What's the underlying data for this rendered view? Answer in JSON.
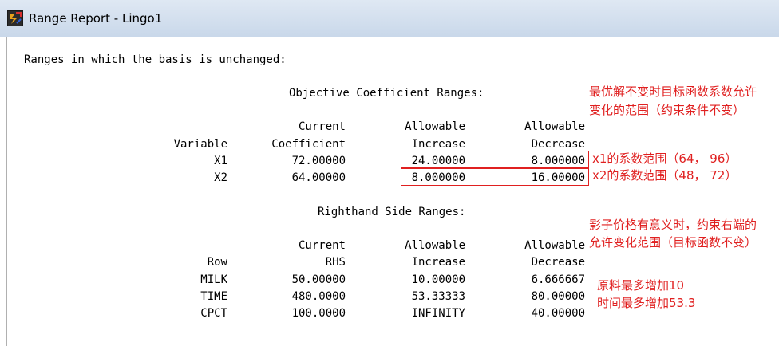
{
  "window": {
    "title": "Range Report - Lingo1",
    "icon": "lingo-app-icon"
  },
  "report": {
    "intro": "Ranges in which the basis is unchanged:",
    "objective": {
      "heading": "Objective Coefficient Ranges:",
      "header1": [
        "Current",
        "Allowable",
        "Allowable"
      ],
      "header2": [
        "Variable",
        "Coefficient",
        "Increase",
        "Decrease"
      ],
      "rows": [
        [
          "X1",
          "72.00000",
          "24.00000",
          "8.000000"
        ],
        [
          "X2",
          "64.00000",
          "8.000000",
          "16.00000"
        ]
      ]
    },
    "rhs": {
      "heading": "Righthand Side Ranges:",
      "header1": [
        "Current",
        "Allowable",
        "Allowable"
      ],
      "header2": [
        "Row",
        "RHS",
        "Increase",
        "Decrease"
      ],
      "rows": [
        [
          "MILK",
          "50.00000",
          "10.00000",
          "6.666667"
        ],
        [
          "TIME",
          "480.0000",
          "53.33333",
          "80.00000"
        ],
        [
          "CPCT",
          "100.0000",
          "INFINITY",
          "40.00000"
        ]
      ]
    }
  },
  "annotations": {
    "color": "#e02020",
    "note1_line1": "最优解不变时目标函数系数允许",
    "note1_line2": "变化的范围（约束条件不变）",
    "x1_range": "x1的系数范围（64， 96）",
    "x2_range": "x2的系数范围（48， 72）",
    "note2_line1": "影子价格有意义时，约束右端的",
    "note2_line2": "允许变化范围（目标函数不变）",
    "note3_line1": "原料最多增加10",
    "note3_line2": "时间最多增加53.3"
  }
}
